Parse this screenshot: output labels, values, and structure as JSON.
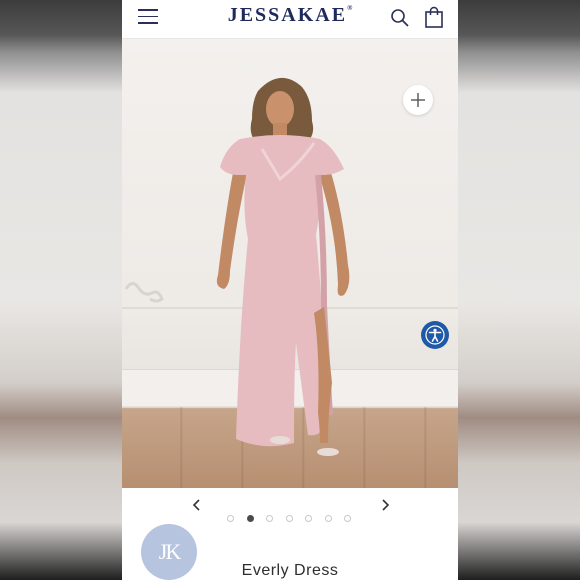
{
  "header": {
    "logo_text": "JESSAKAE",
    "logo_mark": "®",
    "menu_icon": "hamburger-menu-icon",
    "search_icon": "search-icon",
    "bag_icon": "shopping-bag-icon"
  },
  "gallery": {
    "zoom_icon": "plus-icon",
    "accessibility_icon": "accessibility-icon",
    "prev_icon": "chevron-left-icon",
    "next_icon": "chevron-right-icon",
    "total_images": 7,
    "active_index": 2
  },
  "product": {
    "brand_initials": "JK",
    "title": "Everly Dress"
  },
  "colors": {
    "brand_navy": "#1f2a5c",
    "accessibility_blue": "#1f5aa6",
    "badge_blue": "#b7c4df",
    "dress_pink": "#e6bcc0"
  }
}
